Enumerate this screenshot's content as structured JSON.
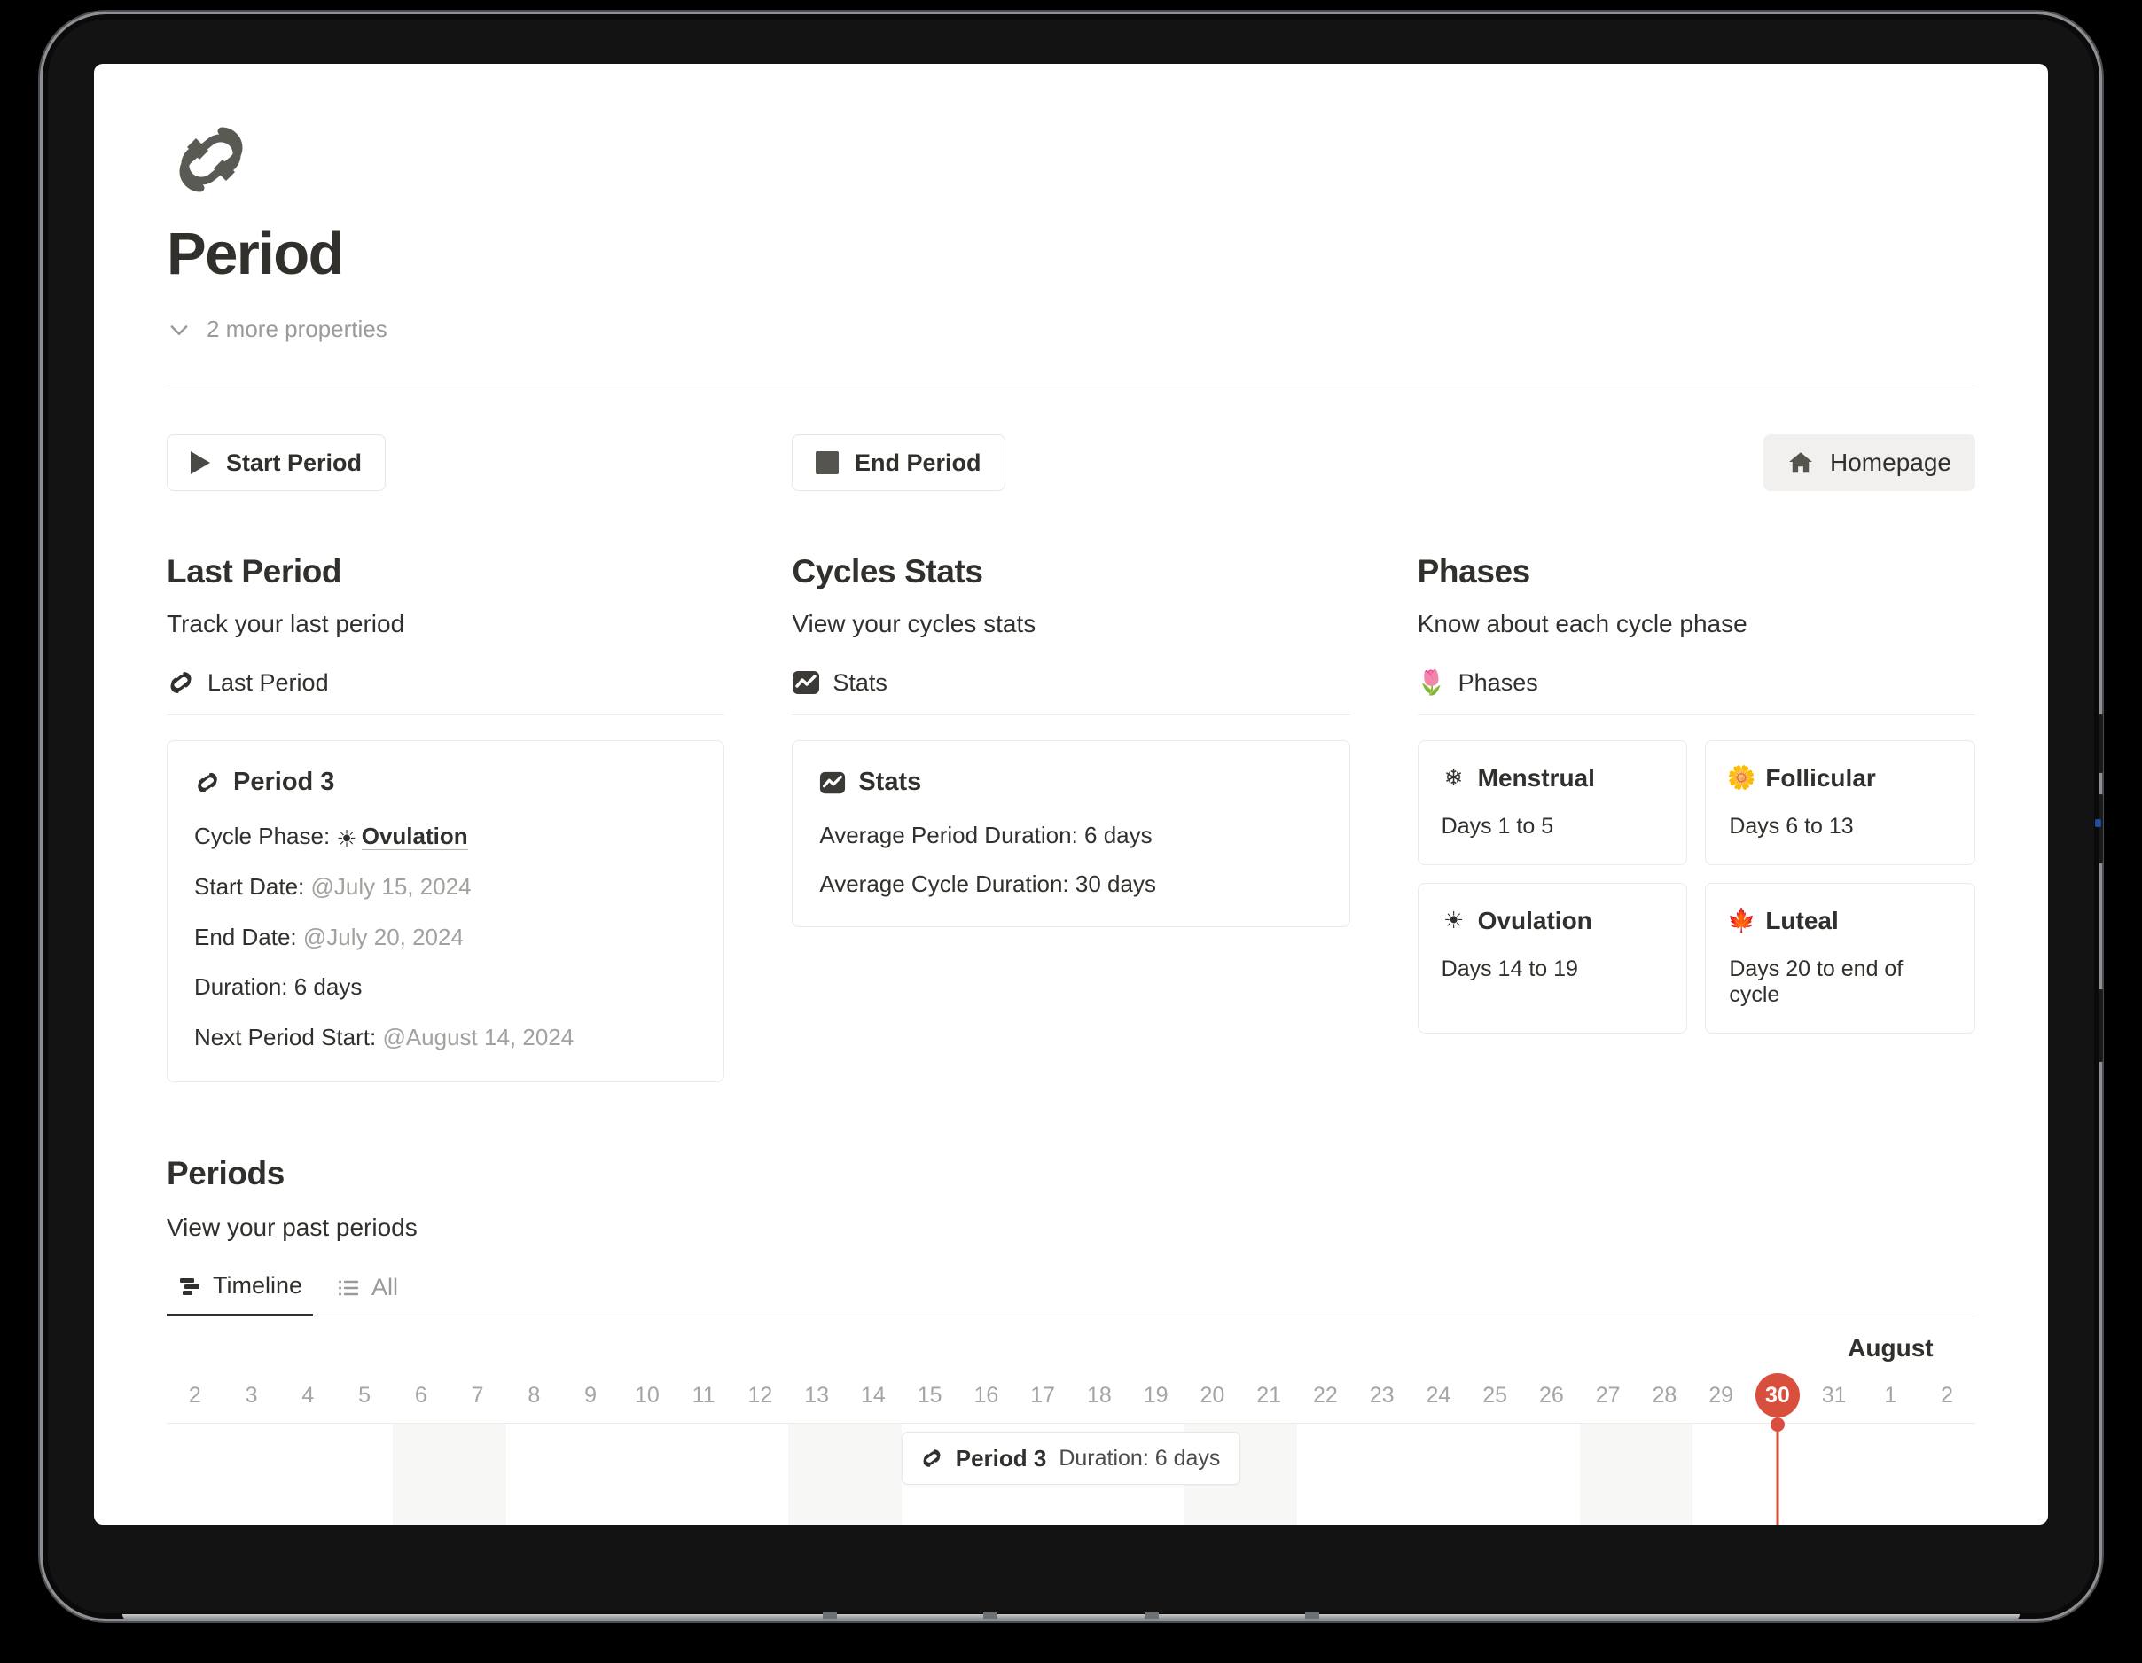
{
  "page": {
    "icon": "link-icon",
    "title": "Period",
    "properties_toggle_label": "2 more properties"
  },
  "toolbar": {
    "start_period_label": "Start Period",
    "end_period_label": "End Period",
    "homepage_label": "Homepage"
  },
  "last_period": {
    "title": "Last Period",
    "subtitle": "Track your last period",
    "db_title": "Last Period",
    "card": {
      "name": "Period 3",
      "cycle_phase_label": "Cycle Phase:",
      "cycle_phase_value": "Ovulation",
      "start_date_label": "Start Date:",
      "start_date_value": "@July 15, 2024",
      "end_date_label": "End Date:",
      "end_date_value": "@July 20, 2024",
      "duration_label": "Duration:",
      "duration_value": "6 days",
      "next_start_label": "Next Period Start:",
      "next_start_value": "@August 14, 2024"
    }
  },
  "cycles_stats": {
    "title": "Cycles Stats",
    "subtitle": "View your cycles stats",
    "db_title": "Stats",
    "card": {
      "name": "Stats",
      "avg_period_duration": "Average Period Duration: 6 days",
      "avg_cycle_duration": "Average Cycle Duration: 30 days"
    }
  },
  "phases": {
    "title": "Phases",
    "subtitle": "Know about each cycle phase",
    "db_title": "Phases",
    "items": [
      {
        "name": "Menstrual",
        "icon": "snowflake-icon",
        "days": "Days 1 to 5"
      },
      {
        "name": "Follicular",
        "icon": "flower-icon",
        "days": "Days 6 to 13"
      },
      {
        "name": "Ovulation",
        "icon": "sun-icon",
        "days": "Days 14 to 19"
      },
      {
        "name": "Luteal",
        "icon": "leaf-icon",
        "days": "Days 20 to end of cycle"
      }
    ]
  },
  "periods": {
    "title": "Periods",
    "subtitle": "View your past periods",
    "tabs": [
      {
        "label": "Timeline",
        "icon": "timeline-icon",
        "active": true
      },
      {
        "label": "All",
        "icon": "list-icon",
        "active": false
      }
    ],
    "timeline": {
      "month_label": "August",
      "days": [
        "2",
        "3",
        "4",
        "5",
        "6",
        "7",
        "8",
        "9",
        "10",
        "11",
        "12",
        "13",
        "14",
        "15",
        "16",
        "17",
        "18",
        "19",
        "20",
        "21",
        "22",
        "23",
        "24",
        "25",
        "26",
        "27",
        "28",
        "29",
        "30",
        "31",
        "1",
        "2"
      ],
      "today": "30",
      "today_index": 28,
      "weekend_indices": [
        4,
        5,
        11,
        12,
        18,
        19,
        25,
        26
      ],
      "accent_color": "#d94f3d",
      "bar": {
        "name": "Period 3",
        "meta": "Duration: 6 days",
        "start_index": 13,
        "span": 6
      }
    }
  }
}
